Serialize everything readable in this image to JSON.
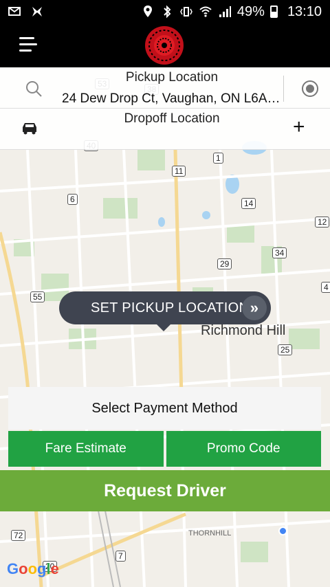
{
  "status_bar": {
    "battery": "49%",
    "time": "13:10"
  },
  "header": {
    "menu_icon": "hamburger-menu-icon",
    "logo": "red-ornamental-logo"
  },
  "location": {
    "pickup_label": "Pickup Location",
    "pickup_value": "24 Dew Drop Ct, Vaughan, ON L6A, C...",
    "dropoff_label": "Dropoff Location"
  },
  "map": {
    "city_label": "Richmond Hill",
    "area_label": "THORNHILL",
    "route_shields": [
      "53",
      "38",
      "40",
      "11",
      "1",
      "6",
      "14",
      "12",
      "34",
      "29",
      "55",
      "4",
      "25",
      "72",
      "7",
      "20"
    ],
    "attribution": "Google"
  },
  "pickup_bubble": {
    "label": "SET PICKUP LOCATION"
  },
  "payment": {
    "label": "Select Payment Method"
  },
  "buttons": {
    "fare_estimate": "Fare Estimate",
    "promo_code": "Promo Code",
    "request_driver": "Request Driver"
  },
  "colors": {
    "green_button": "#21a243",
    "request_button": "#6cab3a",
    "bubble": "#3f4450",
    "location_dot": "#4285f4"
  }
}
